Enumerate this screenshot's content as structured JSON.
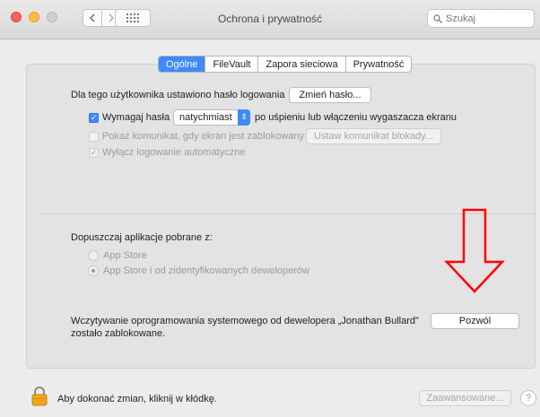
{
  "window": {
    "title": "Ochrona i prywatność",
    "search_placeholder": "Szukaj"
  },
  "tabs": [
    {
      "label": "Ogólne",
      "active": true
    },
    {
      "label": "FileVault",
      "active": false
    },
    {
      "label": "Zapora sieciowa",
      "active": false
    },
    {
      "label": "Prywatność",
      "active": false
    }
  ],
  "general": {
    "password_set_text": "Dla tego użytkownika ustawiono hasło logowania",
    "change_password_button": "Zmień hasło...",
    "require_password_label": "Wymagaj hasła",
    "require_password_value": "natychmiast",
    "require_password_suffix": "po uśpieniu lub włączeniu wygaszacza ekranu",
    "show_message_label": "Pokaż komunikat, gdy ekran jest zablokowany",
    "set_lock_message_button": "Ustaw komunikat blokady...",
    "disable_autologin_label": "Wyłącz logowanie automatyczne"
  },
  "downloads": {
    "heading": "Dopuszczaj aplikacje pobrane z:",
    "option_app_store": "App Store",
    "option_identified": "App Store i od zidentyfikowanych deweloperów"
  },
  "blocked": {
    "line1": "Wczytywanie oprogramowania systemowego od dewelopera „Jonathan Bullard”",
    "line2": "zostało zablokowane.",
    "allow_button": "Pozwól"
  },
  "footer": {
    "lock_text": "Aby dokonać zmian, kliknij w kłódkę.",
    "advanced_button": "Zaawansowane...",
    "help": "?"
  },
  "colors": {
    "accent": "#3f8af7",
    "annotation_arrow": "#ff0000"
  }
}
